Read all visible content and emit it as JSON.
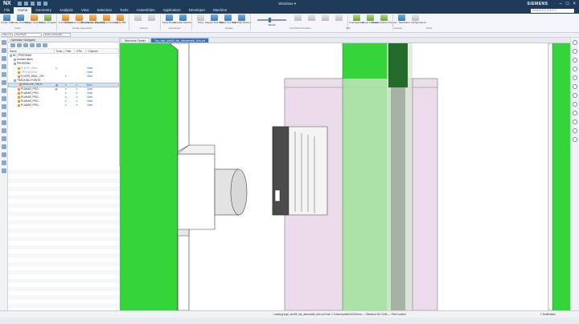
{
  "app": {
    "logo": "NX",
    "window_title": "Windows ▾",
    "brand": "SIEMENS",
    "search_placeholder": "Search NX (Ctrl+F)"
  },
  "menu": [
    "File",
    "Home",
    "Geometry",
    "Analysis",
    "View",
    "Selection",
    "Tools",
    "Assemblies",
    "Application",
    "Developer",
    "Machine"
  ],
  "ribbon": {
    "buttons": [
      {
        "label": "Create Tool",
        "color": "b"
      },
      {
        "label": "Create Geometry",
        "color": "b"
      },
      {
        "label": "Create Operation",
        "color": "o"
      },
      {
        "label": "Create Program",
        "color": "g"
      },
      {
        "label": "Contour Area",
        "color": "o"
      },
      {
        "label": "Fixed Axis Guiding Curves",
        "color": "o"
      },
      {
        "label": "3D Adaptive Roughing",
        "color": "o"
      },
      {
        "label": "Rest Milling Flowlines",
        "color": "o"
      },
      {
        "label": "Cavity Mill",
        "color": "o"
      },
      {
        "label": "",
        "color": "d"
      },
      {
        "label": "",
        "color": "d"
      },
      {
        "label": "Verify Report",
        "color": "b"
      },
      {
        "label": "Simulate Machine",
        "color": "b"
      },
      {
        "label": "Show",
        "color": "d"
      },
      {
        "label": "Display Tool Path",
        "color": "b"
      },
      {
        "label": "Select Tool Path",
        "color": "b"
      },
      {
        "label": "Tool Path Refresh",
        "color": "b"
      },
      {
        "label": "",
        "color": "d"
      },
      {
        "label": "",
        "color": "d"
      },
      {
        "label": "",
        "color": "d"
      },
      {
        "label": "",
        "color": "d"
      },
      {
        "label": "Find Features",
        "color": "g"
      },
      {
        "label": "Group Features",
        "color": "g"
      },
      {
        "label": "Create Feature Process",
        "color": "g"
      },
      {
        "label": "More",
        "color": "b"
      },
      {
        "label": "More Configurations",
        "color": "d"
      }
    ],
    "groups": [
      "Insert",
      "Create Operations",
      "Actions",
      "Operations",
      "Display",
      "Tool Path Animation",
      "IPW",
      "Feature",
      "Tools"
    ],
    "speed_label": "Speed"
  },
  "toolbar2": {
    "menu_select": "Menu ▾",
    "filter": "Tool Path",
    "assembly_filter": "Entire Assembly"
  },
  "navigator": {
    "title": "Operation Navigator",
    "columns": [
      "Name",
      "Toolc...",
      "Path",
      "IPW",
      "Channel"
    ],
    "rows": [
      {
        "name": "NC_PROGRAM",
        "indent": 0,
        "toolc": "",
        "path": "",
        "ipw": "",
        "chan": "",
        "icon": "b"
      },
      {
        "name": "Unused Items",
        "indent": 1,
        "toolc": "",
        "path": "",
        "ipw": "",
        "chan": "",
        "icon": "b"
      },
      {
        "name": "PROGRAM",
        "indent": 1,
        "toolc": "",
        "path": "",
        "ipw": "",
        "chan": "",
        "icon": "b"
      },
      {
        "name": "FLOOR_WALL",
        "indent": 2,
        "toolc": "▤",
        "path": "",
        "ipw": "",
        "chan": "Main",
        "icon": "o",
        "dim": true
      },
      {
        "name": "TROCHOIDAL",
        "indent": 2,
        "toolc": "",
        "path": "",
        "ipw": "",
        "chan": "Main",
        "icon": "o",
        "dim": true
      },
      {
        "name": "FLOOR_WALL_OR...",
        "indent": 2,
        "toolc": "",
        "path": "✔",
        "ipw": "",
        "chan": "Main",
        "icon": "o"
      },
      {
        "name": "TRACKING-POINTS",
        "indent": 1,
        "toolc": "",
        "path": "",
        "ipw": "",
        "chan": "",
        "icon": "b"
      },
      {
        "name": "GROOVE_PROF...",
        "indent": 2,
        "toolc": "▤",
        "path": "✔",
        "ipw": "✔",
        "chan": "Main",
        "icon": "o",
        "selected": true
      },
      {
        "name": "PLANAR_PRO...",
        "indent": 2,
        "toolc": "▤",
        "path": "✔",
        "ipw": "✔",
        "chan": "Main",
        "icon": "o"
      },
      {
        "name": "PLANAR_PRO...",
        "indent": 2,
        "toolc": "",
        "path": "✔",
        "ipw": "✔",
        "chan": "Main",
        "icon": "o"
      },
      {
        "name": "PLANAR_PRO...",
        "indent": 2,
        "toolc": "",
        "path": "✔",
        "ipw": "✔",
        "chan": "Main",
        "icon": "o"
      },
      {
        "name": "PLANAR_PRO...",
        "indent": 2,
        "toolc": "",
        "path": "✔",
        "ipw": "✔",
        "chan": "Main",
        "icon": "o"
      },
      {
        "name": "PLANAR_PRO...",
        "indent": 2,
        "toolc": "",
        "path": "✔",
        "ipw": "✔",
        "chan": "Main",
        "icon": "o"
      }
    ]
  },
  "tabs": [
    {
      "label": "Welcome Center",
      "active": false
    },
    {
      "label": "Top_mpl_sim05_fas_mtsoemelk_trim.prt",
      "active": true
    }
  ],
  "status": {
    "message": "Loading tmpl_sim05_fas_tatsumelk_trim.prt from C:\\Users\\public\\NX\\Demo — Siemens NX CAM — Part Loaded",
    "right": "1 Notification"
  },
  "colors": {
    "green": "#35d43a",
    "pink": "#e6cfe3",
    "dark_green": "#256b2c",
    "accent": "#1f3b5a"
  }
}
